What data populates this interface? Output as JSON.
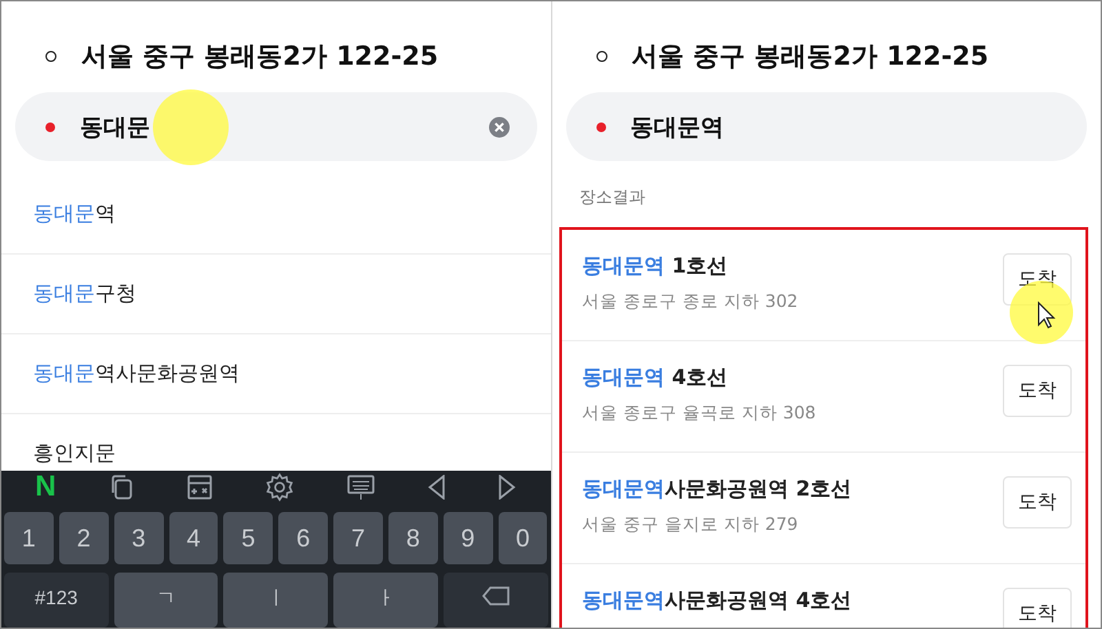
{
  "left": {
    "origin": "서울 중구 봉래동2가 122-25",
    "destination": {
      "value": "동대문",
      "clear": true
    },
    "suggestions": [
      {
        "match": "동대문",
        "rest": "역"
      },
      {
        "match": "동대문",
        "rest": "구청"
      },
      {
        "match": "동대문",
        "rest": "역사문화공원역"
      },
      {
        "rest": "흥인지문"
      }
    ],
    "keyboard": {
      "toolbar": [
        {
          "kind": "logo",
          "label": "N"
        },
        {
          "kind": "copy"
        },
        {
          "kind": "calculator"
        },
        {
          "kind": "settings"
        },
        {
          "kind": "keyboard"
        },
        {
          "kind": "left"
        },
        {
          "kind": "right"
        }
      ],
      "number_keys": [
        "1",
        "2",
        "3",
        "4",
        "5",
        "6",
        "7",
        "8",
        "9",
        "0"
      ],
      "bottom_keys": [
        {
          "kind": "mode",
          "label": "#123"
        },
        {
          "kind": "letter",
          "label": "ㄱ"
        },
        {
          "kind": "letter",
          "label": "ㅣ"
        },
        {
          "kind": "letter",
          "label": "ㅏ"
        },
        {
          "kind": "backspace"
        }
      ]
    }
  },
  "right": {
    "origin": "서울 중구 봉래동2가 122-25",
    "destination": {
      "value": "동대문역",
      "clear": false
    },
    "section_title": "장소결과",
    "results": [
      {
        "match": "동대문역",
        "rest": " 1호선",
        "address": "서울 종로구 종로 지하 302",
        "button": "도착"
      },
      {
        "match": "동대문역",
        "rest": " 4호선",
        "address": "서울 종로구 율곡로 지하 308",
        "button": "도착"
      },
      {
        "match": "동대문역",
        "rest": "사문화공원역 2호선",
        "address": "서울 중구 을지로 지하 279",
        "button": "도착"
      },
      {
        "match": "동대문역",
        "rest": "사문화공원역 4호선",
        "button": "도착"
      }
    ]
  }
}
